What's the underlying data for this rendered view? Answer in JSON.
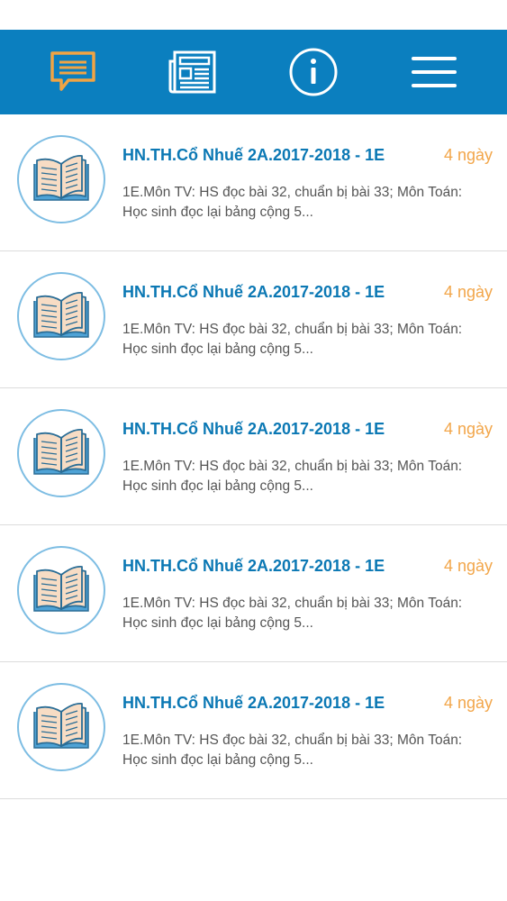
{
  "colors": {
    "nav_bg": "#0b7fbf",
    "active_icon": "#f0a444",
    "inactive_icon": "#ffffff",
    "title": "#0b78b4",
    "time": "#f2a64a",
    "preview": "#555555"
  },
  "nav": {
    "items": [
      {
        "icon": "chat-bubble-icon",
        "active": true
      },
      {
        "icon": "newspaper-icon",
        "active": false
      },
      {
        "icon": "info-icon",
        "active": false
      },
      {
        "icon": "menu-icon",
        "active": false
      }
    ]
  },
  "messages": [
    {
      "icon": "open-book-icon",
      "title": "HN.TH.Cổ Nhuế 2A.2017-2018 - 1E",
      "time": "4 ngày",
      "preview": "1E.Môn TV: HS đọc bài 32, chuẩn bị bài 33; Môn Toán: Học sinh đọc lại bảng cộng 5..."
    },
    {
      "icon": "open-book-icon",
      "title": "HN.TH.Cổ Nhuế 2A.2017-2018 - 1E",
      "time": "4 ngày",
      "preview": "1E.Môn TV: HS đọc bài 32, chuẩn bị bài 33; Môn Toán: Học sinh đọc lại bảng cộng 5..."
    },
    {
      "icon": "open-book-icon",
      "title": "HN.TH.Cổ Nhuế 2A.2017-2018 - 1E",
      "time": "4 ngày",
      "preview": "1E.Môn TV: HS đọc bài 32, chuẩn bị bài 33; Môn Toán: Học sinh đọc lại bảng cộng 5..."
    },
    {
      "icon": "open-book-icon",
      "title": "HN.TH.Cổ Nhuế 2A.2017-2018 - 1E",
      "time": "4 ngày",
      "preview": "1E.Môn TV: HS đọc bài 32, chuẩn bị bài 33; Môn Toán: Học sinh đọc lại bảng cộng 5..."
    },
    {
      "icon": "open-book-icon",
      "title": "HN.TH.Cổ Nhuế 2A.2017-2018 - 1E",
      "time": "4 ngày",
      "preview": "1E.Môn TV: HS đọc bài 32, chuẩn bị bài 33; Môn Toán: Học sinh đọc lại bảng cộng 5..."
    }
  ]
}
